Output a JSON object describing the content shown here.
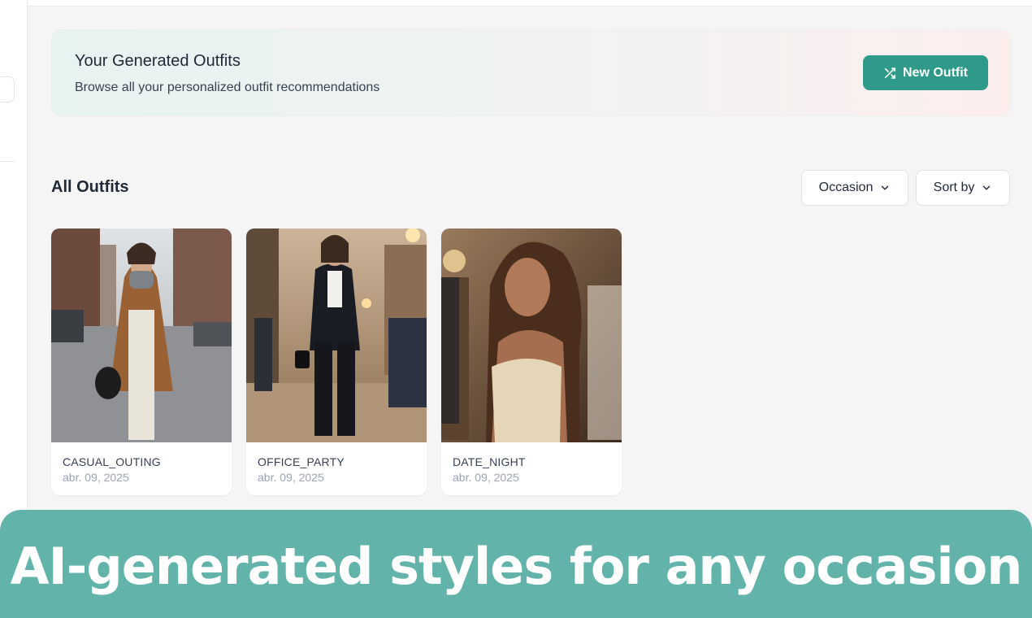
{
  "hero": {
    "title": "Your Generated Outfits",
    "subtitle": "Browse all your personalized outfit recommendations",
    "new_button_label": "New Outfit"
  },
  "section": {
    "title": "All Outfits",
    "filters": {
      "occasion_label": "Occasion",
      "sort_label": "Sort by"
    }
  },
  "outfits": [
    {
      "occasion": "CASUAL_OUTING",
      "date": "abr. 09, 2025"
    },
    {
      "occasion": "OFFICE_PARTY",
      "date": "abr. 09, 2025"
    },
    {
      "occasion": "DATE_NIGHT",
      "date": "abr. 09, 2025"
    }
  ],
  "banner": {
    "text": "AI-generated styles for any occasion"
  },
  "colors": {
    "accent": "#2f9a89",
    "banner": "#62b3a9",
    "background": "#f5f5f5"
  },
  "icons": {
    "new_outfit": "shuffle-icon",
    "dropdown": "chevron-down-icon"
  }
}
